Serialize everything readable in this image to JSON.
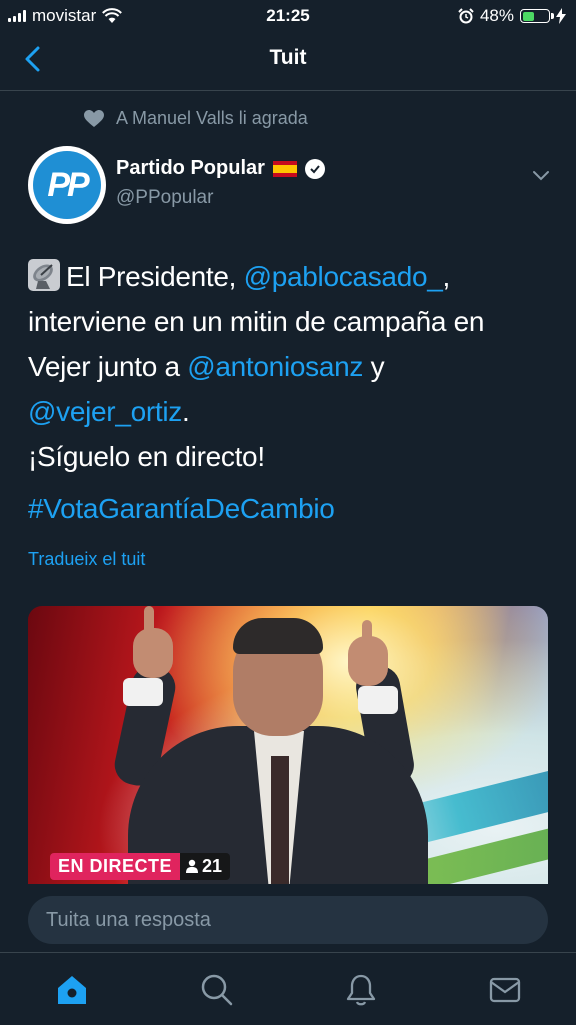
{
  "status_bar": {
    "carrier": "movistar",
    "time": "21:25",
    "battery": "48%",
    "battery_level": 0.48
  },
  "nav": {
    "title": "Tuit"
  },
  "social_context": {
    "text": "A Manuel Valls li agrada"
  },
  "author": {
    "name": "Partido Popular",
    "handle": "@PPopular",
    "avatar_text": "PP"
  },
  "tweet": {
    "t1": "El Presidente, ",
    "m1": "@pablocasado_",
    "t2": ",",
    "t3": "interviene en un mitin de campaña en",
    "t4": "Vejer junto a ",
    "m2": "@antoniosanz",
    "t5": " y",
    "m3": "@vejer_ortiz",
    "t6": ".",
    "t7": "¡Síguelo en directo!",
    "hashtag": "#VotaGarantíaDeCambio",
    "translate": "Tradueix el tuit"
  },
  "video": {
    "live_label": "EN DIRECTE",
    "viewers": "21"
  },
  "reply": {
    "placeholder": "Tuita una resposta"
  },
  "tabs": [
    {
      "icon": "home-icon",
      "active": true
    },
    {
      "icon": "search-icon",
      "active": false
    },
    {
      "icon": "notifications-bell-icon",
      "active": false
    },
    {
      "icon": "messages-envelope-icon",
      "active": false
    }
  ],
  "colors": {
    "background": "#15202b",
    "accent": "#1da1f2",
    "muted": "#8899a6",
    "live": "#e0245e"
  }
}
